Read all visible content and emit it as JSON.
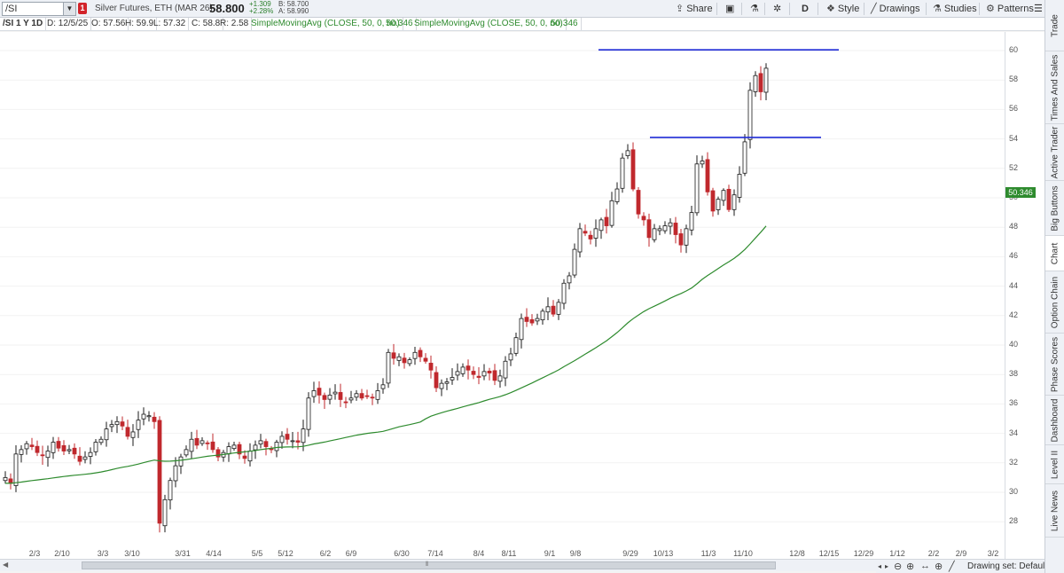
{
  "toolbar": {
    "symbol": "/SI",
    "alert_badge": "1",
    "description": "Silver Futures, ETH (MAR 26)",
    "last": "58.800",
    "change_abs": "+1.309",
    "change_pct": "+2.28%",
    "bid": "B: 58.700",
    "ask": "A: 58.990",
    "share_label": "Share",
    "aggregation": "D",
    "style_label": "Style",
    "drawings_label": "Drawings",
    "studies_label": "Studies",
    "patterns_label": "Patterns"
  },
  "info": {
    "title": "/SI 1 Y 1D",
    "date": "D: 12/5/25",
    "open": "O: 57.56",
    "high": "H: 59.9",
    "low": "L: 57.32",
    "close": "C: 58.8",
    "range": "R: 2.58",
    "study1": "SimpleMovingAvg (CLOSE, 50, 0, no)",
    "study1_value": "50.346",
    "study2": "SimpleMovingAvg (CLOSE, 50, 0, no)",
    "study2_value": "50.346"
  },
  "colors": {
    "up": "#1a1a1a",
    "down": "#c0282d",
    "sma": "#2e8b2e",
    "trendline": "#1f2bd6"
  },
  "price_axis": {
    "ticks": [
      "60",
      "58",
      "56",
      "54",
      "52",
      "50",
      "48",
      "46",
      "44",
      "42",
      "40",
      "38",
      "36",
      "34",
      "32",
      "30",
      "28"
    ],
    "sma_tag": "50.346"
  },
  "date_axis": {
    "ticks": [
      "2/3",
      "2/10",
      "3/3",
      "3/10",
      "3/31",
      "4/14",
      "5/5",
      "5/12",
      "6/2",
      "6/9",
      "6/30",
      "7/14",
      "8/4",
      "8/11",
      "9/1",
      "9/8",
      "9/29",
      "10/13",
      "11/3",
      "11/10",
      "12/8",
      "12/15",
      "12/29",
      "1/12",
      "2/2",
      "2/9",
      "3/2"
    ]
  },
  "chart_data": {
    "type": "candlestick",
    "ylim": [
      27,
      61
    ],
    "closes": [
      31.0,
      30.6,
      32.6,
      32.9,
      33.3,
      33.1,
      32.7,
      32.5,
      32.8,
      33.4,
      33.0,
      32.8,
      32.9,
      32.6,
      32.1,
      32.4,
      32.7,
      33.4,
      33.6,
      34.3,
      34.6,
      34.8,
      34.5,
      33.8,
      34.1,
      34.9,
      35.3,
      35.2,
      34.8,
      27.9,
      29.5,
      30.8,
      31.8,
      32.4,
      32.9,
      33.6,
      33.2,
      33.5,
      33.3,
      32.9,
      32.4,
      32.7,
      33.1,
      33.2,
      32.6,
      32.3,
      32.8,
      33.2,
      33.5,
      33.1,
      32.9,
      33.4,
      33.8,
      33.6,
      33.5,
      33.4,
      34.3,
      36.4,
      36.9,
      36.6,
      36.3,
      36.6,
      36.8,
      36.3,
      36.1,
      36.4,
      36.7,
      36.4,
      36.5,
      36.4,
      36.9,
      37.3,
      39.5,
      39.1,
      39.2,
      38.8,
      39.0,
      39.5,
      39.2,
      38.9,
      38.3,
      37.1,
      37.4,
      37.5,
      37.8,
      38.2,
      38.5,
      38.3,
      38.0,
      37.8,
      38.2,
      38.1,
      37.6,
      37.9,
      38.9,
      39.4,
      40.5,
      41.8,
      41.6,
      41.5,
      41.8,
      42.3,
      42.6,
      42.1,
      42.9,
      44.2,
      44.7,
      46.5,
      47.9,
      47.6,
      47.2,
      47.9,
      48.5,
      48.1,
      49.8,
      50.6,
      52.7,
      53.2,
      50.6,
      48.9,
      48.5,
      47.3,
      47.9,
      47.9,
      48.1,
      48.3,
      47.5,
      46.8,
      47.9,
      49.0,
      52.3,
      52.5,
      50.4,
      49.1,
      49.9,
      50.5,
      49.2,
      50.2,
      51.6,
      53.8,
      57.3,
      58.3,
      57.2,
      58.8
    ]
  }
}
